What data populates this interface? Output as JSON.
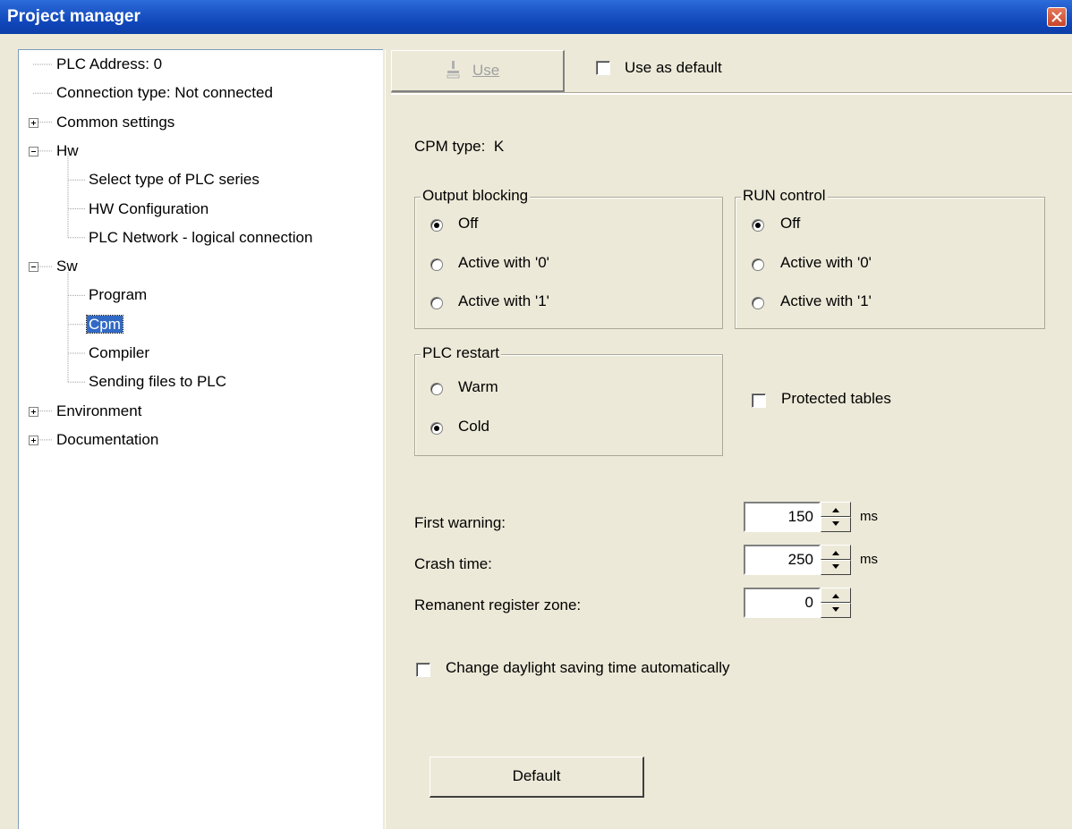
{
  "window": {
    "title": "Project manager"
  },
  "tree": {
    "items": [
      {
        "label": "PLC Address: 0",
        "level": 0,
        "expander": "none"
      },
      {
        "label": "Connection type: Not connected",
        "level": 0,
        "expander": "none"
      },
      {
        "label": "Common settings",
        "level": 0,
        "expander": "plus"
      },
      {
        "label": "Hw",
        "level": 0,
        "expander": "minus"
      },
      {
        "label": "Select type of PLC series",
        "level": 1,
        "expander": "none"
      },
      {
        "label": "HW Configuration",
        "level": 1,
        "expander": "none"
      },
      {
        "label": "PLC Network - logical connection",
        "level": 1,
        "expander": "none"
      },
      {
        "label": "Sw",
        "level": 0,
        "expander": "minus"
      },
      {
        "label": "Program",
        "level": 1,
        "expander": "none"
      },
      {
        "label": "Cpm",
        "level": 1,
        "expander": "none",
        "selected": true
      },
      {
        "label": "Compiler",
        "level": 1,
        "expander": "none"
      },
      {
        "label": "Sending files to PLC",
        "level": 1,
        "expander": "none"
      },
      {
        "label": "Environment",
        "level": 0,
        "expander": "plus"
      },
      {
        "label": "Documentation",
        "level": 0,
        "expander": "plus"
      }
    ]
  },
  "toolbar": {
    "use_label": "Use",
    "use_as_default_label": "Use as default"
  },
  "cpm": {
    "type_label": "CPM type:",
    "type_value": "K",
    "output_blocking": {
      "title": "Output blocking",
      "options": [
        "Off",
        "Active with '0'",
        "Active with '1'"
      ],
      "selected": "Off"
    },
    "run_control": {
      "title": "RUN control",
      "options": [
        "Off",
        "Active with '0'",
        "Active with '1'"
      ],
      "selected": "Off"
    },
    "plc_restart": {
      "title": "PLC restart",
      "options": [
        "Warm",
        "Cold"
      ],
      "selected": "Cold"
    },
    "protected_tables_label": "Protected tables",
    "first_warning": {
      "label": "First warning:",
      "value": "150",
      "unit": "ms"
    },
    "crash_time": {
      "label": "Crash time:",
      "value": "250",
      "unit": "ms"
    },
    "remanent_zone": {
      "label": "Remanent register zone:",
      "value": "0"
    },
    "daylight_label": "Change daylight saving time automatically",
    "default_button": "Default"
  }
}
